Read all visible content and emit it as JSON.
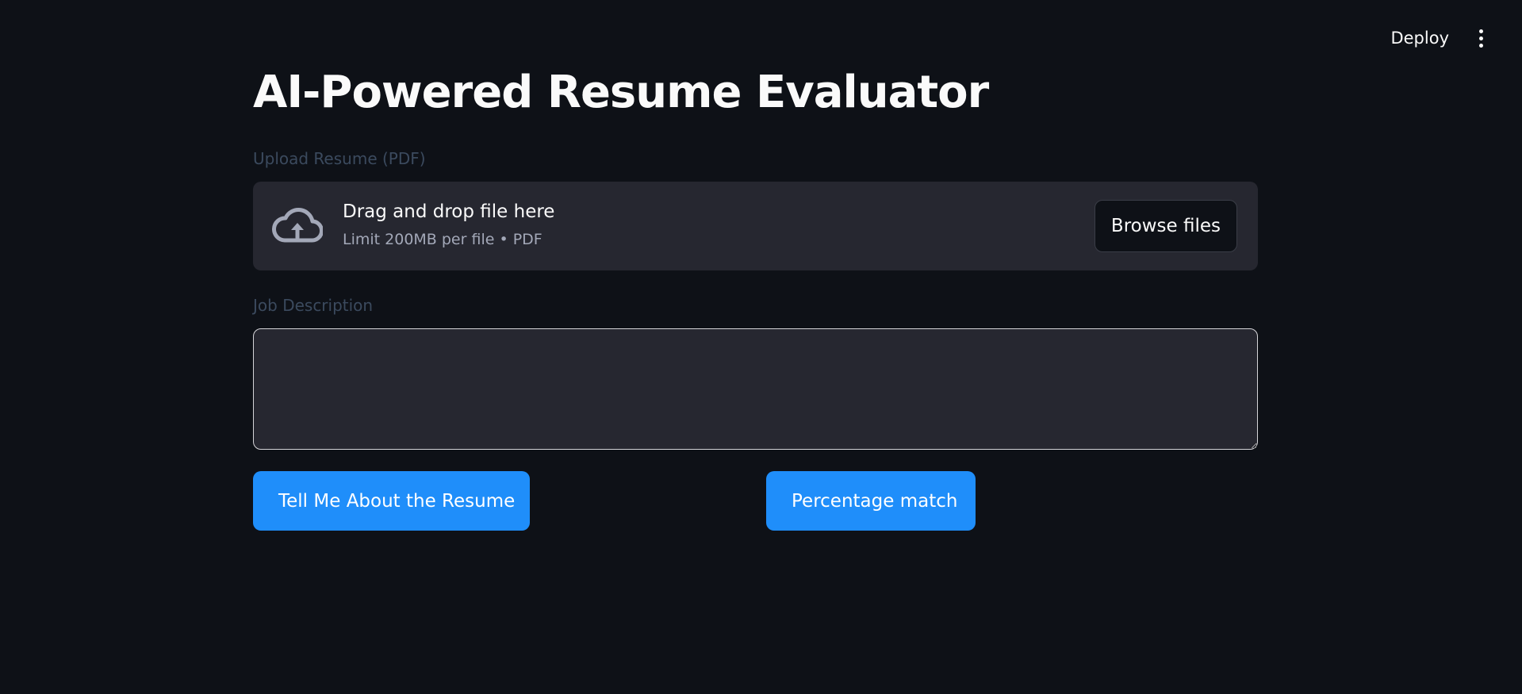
{
  "toolbar": {
    "deploy_label": "Deploy",
    "menu_icon": "kebab-menu-icon"
  },
  "main": {
    "title": "AI-Powered Resume Evaluator",
    "upload": {
      "label": "Upload Resume (PDF)",
      "icon": "cloud-upload-icon",
      "drop_text": "Drag and drop file here",
      "limit_text": "Limit 200MB per file • PDF",
      "browse_label": "Browse files"
    },
    "job_description": {
      "label": "Job Description",
      "value": ""
    },
    "actions": {
      "tell_label": "Tell Me About the Resume",
      "match_label": "Percentage match"
    }
  },
  "colors": {
    "background": "#0e1117",
    "panel": "#262730",
    "primary_button": "#1f8efa",
    "label": "#3b4a5e"
  }
}
